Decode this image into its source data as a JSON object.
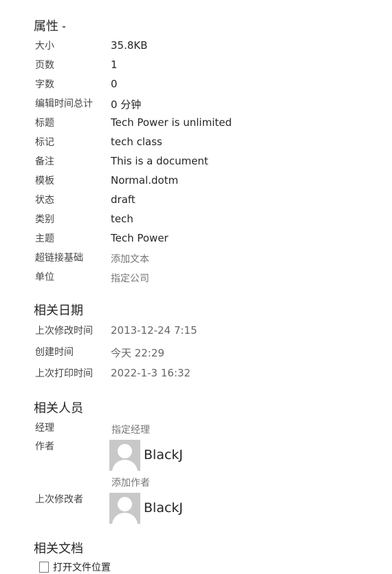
{
  "properties": {
    "title": "属性",
    "rows": [
      {
        "label": "大小",
        "value": "35.8KB"
      },
      {
        "label": "页数",
        "value": "1"
      },
      {
        "label": "字数",
        "value": "0"
      },
      {
        "label": "编辑时间总计",
        "value": "0 分钟"
      },
      {
        "label": "标题",
        "value": "Tech Power is unlimited"
      },
      {
        "label": "标记",
        "value": "tech class"
      },
      {
        "label": "备注",
        "value": "This is a document"
      },
      {
        "label": "模板",
        "value": "Normal.dotm"
      },
      {
        "label": "状态",
        "value": "draft"
      },
      {
        "label": "类别",
        "value": "tech"
      },
      {
        "label": "主题",
        "value": "Tech Power"
      },
      {
        "label": "超链接基础",
        "placeholder": "添加文本"
      },
      {
        "label": "单位",
        "placeholder": "指定公司"
      }
    ]
  },
  "related_dates": {
    "title": "相关日期",
    "rows": [
      {
        "label": "上次修改时间",
        "value": "2013-12-24 7:15"
      },
      {
        "label": "创建时间",
        "value": "今天 22:29"
      },
      {
        "label": "上次打印时间",
        "value": "2022-1-3 16:32"
      }
    ]
  },
  "related_people": {
    "title": "相关人员",
    "manager": {
      "label": "经理",
      "placeholder": "指定经理"
    },
    "author": {
      "label": "作者",
      "name": "BlackJ",
      "add_label": "添加作者"
    },
    "last_modified_by": {
      "label": "上次修改者",
      "name": "BlackJ"
    }
  },
  "related_docs": {
    "title": "相关文档",
    "open_location": "打开文件位置"
  },
  "icons": {
    "avatar": "person-placeholder-icon",
    "doc": "document-icon",
    "dropdown": "caret-down-icon"
  }
}
